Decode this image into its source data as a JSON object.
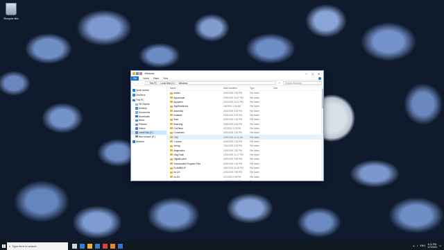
{
  "desktop": {
    "recycle_bin_label": "Recycle Bin"
  },
  "window": {
    "title": "Windows",
    "controls": {
      "minimize": "─",
      "maximize": "☐",
      "close": "✕"
    },
    "ribbon_tabs": [
      "File",
      "Home",
      "Share",
      "View"
    ],
    "address": {
      "back": "←",
      "forward": "→",
      "up": "↑",
      "crumbs": [
        "This PC",
        "Local Disk (C:)",
        "Windows"
      ],
      "refresh": "⟳",
      "search_placeholder": "Search Windows"
    },
    "nav": [
      {
        "label": "Quick access",
        "level": 0,
        "icon": "star-icon",
        "color": "#1f7fd8"
      },
      {
        "label": "OneDrive",
        "level": 0,
        "icon": "cloud-icon",
        "color": "#2f8ae0",
        "gap": true
      },
      {
        "label": "This PC",
        "level": 0,
        "icon": "computer-icon",
        "color": "#3a7fd0",
        "gap": true
      },
      {
        "label": "3D Objects",
        "level": 1,
        "icon": "cube-icon",
        "color": "#7fb3e8"
      },
      {
        "label": "Desktop",
        "level": 1,
        "icon": "desktop-icon",
        "color": "#4a90d9"
      },
      {
        "label": "Documents",
        "level": 1,
        "icon": "documents-icon",
        "color": "#9aa6b3"
      },
      {
        "label": "Downloads",
        "level": 1,
        "icon": "download-icon",
        "color": "#2a7ad0"
      },
      {
        "label": "Music",
        "level": 1,
        "icon": "music-icon",
        "color": "#5b8fd0"
      },
      {
        "label": "Pictures",
        "level": 1,
        "icon": "pictures-icon",
        "color": "#6a9ed8"
      },
      {
        "label": "Videos",
        "level": 1,
        "icon": "video-icon",
        "color": "#5a7fbf"
      },
      {
        "label": "Local Disk (C:)",
        "level": 1,
        "icon": "drive-icon",
        "color": "#7a8a99",
        "selected": true
      },
      {
        "label": "New Volume (E:)",
        "level": 1,
        "icon": "drive-icon",
        "color": "#7a8a99"
      },
      {
        "label": "Network",
        "level": 0,
        "icon": "network-icon",
        "color": "#3b7ac4",
        "gap": true
      }
    ],
    "columns": {
      "name": "Name",
      "date": "Date modified",
      "type": "Type",
      "size": "Size"
    },
    "files": [
      {
        "name": "addins",
        "date": "3/19/2019 2:52 PM",
        "type": "File folder"
      },
      {
        "name": "appcompat",
        "date": "2/19/2019 11:57 PM",
        "type": "File folder"
      },
      {
        "name": "apppatch",
        "date": "3/12/2019 11:03 PM",
        "type": "File folder"
      },
      {
        "name": "AppReadiness",
        "date": "4/4/2019 1:16 AM",
        "type": "File folder"
      },
      {
        "name": "assembly",
        "date": "3/13/2019 3:32 PM",
        "type": "File folder"
      },
      {
        "name": "bcastdvr",
        "date": "3/19/2019 2:52 PM",
        "type": "File folder"
      },
      {
        "name": "Boot",
        "date": "3/19/2019 2:52 PM",
        "type": "File folder"
      },
      {
        "name": "Branding",
        "date": "3/19/2019 2:52 PM",
        "type": "File folder"
      },
      {
        "name": "CbsTemp",
        "date": "4/7/2019 1:15 PM",
        "type": "File folder"
      },
      {
        "name": "Containers",
        "date": "3/19/2019 2:52 PM",
        "type": "File folder"
      },
      {
        "name": "CSC",
        "date": "10/4/2019 11:11 AM",
        "type": "File folder",
        "hover": true
      },
      {
        "name": "Cursors",
        "date": "3/19/2019 2:52 PM",
        "type": "File folder"
      },
      {
        "name": "debug",
        "date": "7/10/2019 3:32 PM",
        "type": "File folder"
      },
      {
        "name": "diagnostics",
        "date": "3/19/2019 2:52 PM",
        "type": "File folder"
      },
      {
        "name": "DiagTrack",
        "date": "3/19/2019 11:17 PM",
        "type": "File folder"
      },
      {
        "name": "DigitalLocker",
        "date": "3/19/2019 2:53 PM",
        "type": "File folder"
      },
      {
        "name": "Downloaded Program Files",
        "date": "3/19/2019 2:52 PM",
        "type": "File folder"
      },
      {
        "name": "ELAMBKUP",
        "date": "3/19/2019 11:28 PM",
        "type": "File folder"
      },
      {
        "name": "en-US",
        "date": "3/19/2019 2:52 PM",
        "type": "File folder"
      },
      {
        "name": "es-ES",
        "date": "1/7/2020 2:08 PM",
        "type": "File folder"
      },
      {
        "name": "Fonts",
        "date": "3/19/2019 2:52 PM",
        "type": "File folder"
      },
      {
        "name": "GameBarPresenceWriter",
        "date": "3/19/2019 2:52 PM",
        "type": "File folder"
      },
      {
        "name": "Globalization",
        "date": "3/19/2019 2:52 PM",
        "type": "File folder"
      }
    ]
  },
  "taskbar": {
    "search_placeholder": "Type here to search",
    "time": "4:11 PM",
    "date": "1/7/2020",
    "lang": "ENG",
    "pinned": [
      {
        "icon": "task-view-icon",
        "color": "#cfd6df"
      },
      {
        "icon": "edge-icon",
        "color": "#2f7fd6"
      },
      {
        "icon": "file-explorer-icon",
        "color": "#e8b33a"
      },
      {
        "icon": "store-icon",
        "color": "#3d7fc8"
      },
      {
        "icon": "app-icon-red",
        "color": "#d8433b"
      },
      {
        "icon": "app-icon-orange",
        "color": "#e38a2b"
      },
      {
        "icon": "app-icon-blue",
        "color": "#3a6fd0"
      }
    ]
  }
}
